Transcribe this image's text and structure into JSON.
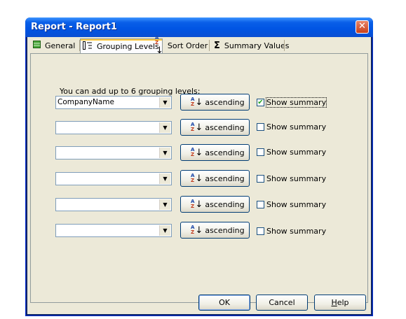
{
  "window": {
    "title": "Report - Report1",
    "close_glyph": "✕"
  },
  "tabs": [
    {
      "label": "General",
      "icon": "table-icon"
    },
    {
      "label": "Grouping Levels",
      "icon": "grouping-icon"
    },
    {
      "label": "Sort Order",
      "icon": "sort-az-icon"
    },
    {
      "label": "Summary Values",
      "icon": "sigma-icon"
    }
  ],
  "instructions": "You can add up to 6 grouping levels:",
  "levels": [
    {
      "field": "CompanyName",
      "sort_label": "ascending",
      "summary_label": "Show summary",
      "summary_checked": "✔"
    },
    {
      "field": "",
      "sort_label": "ascending",
      "summary_label": "Show summary",
      "summary_checked": ""
    },
    {
      "field": "",
      "sort_label": "ascending",
      "summary_label": "Show summary",
      "summary_checked": ""
    },
    {
      "field": "",
      "sort_label": "ascending",
      "summary_label": "Show summary",
      "summary_checked": ""
    },
    {
      "field": "",
      "sort_label": "ascending",
      "summary_label": "Show summary",
      "summary_checked": ""
    },
    {
      "field": "",
      "sort_label": "ascending",
      "summary_label": "Show summary",
      "summary_checked": ""
    }
  ],
  "buttons": {
    "ok": "OK",
    "cancel": "Cancel",
    "help_first": "H",
    "help_rest": "elp"
  }
}
